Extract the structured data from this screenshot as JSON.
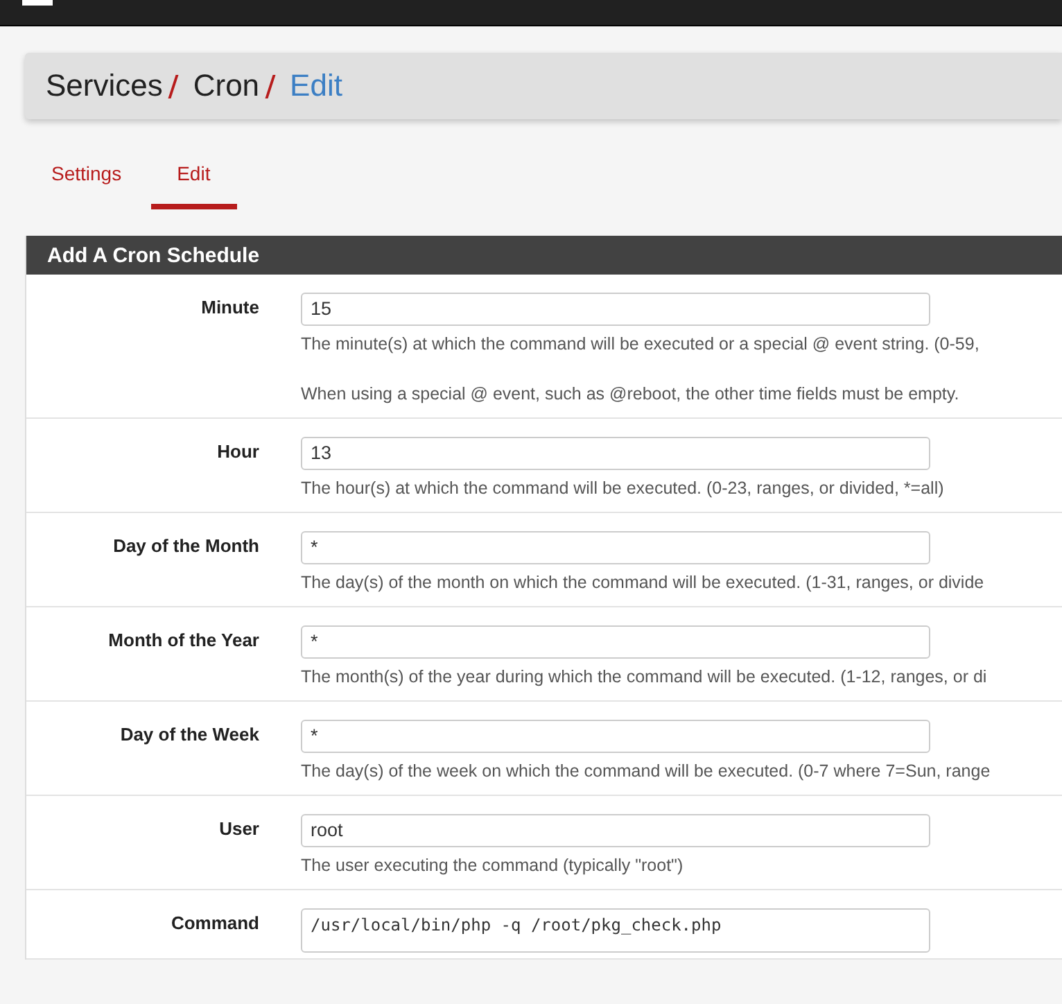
{
  "breadcrumb": [
    {
      "label": "Services",
      "current": false
    },
    {
      "label": "Cron",
      "current": false
    },
    {
      "label": "Edit",
      "current": true
    }
  ],
  "tabs": [
    {
      "label": "Settings",
      "selected": false
    },
    {
      "label": "Edit",
      "selected": true
    }
  ],
  "panel": {
    "title": "Add A Cron Schedule",
    "fields": [
      {
        "label": "Minute",
        "kind": "input",
        "value": "15",
        "help": [
          "The minute(s) at which the command will be executed or a special @ event string. (0-59,",
          "When using a special @ event, such as @reboot, the other time fields must be empty."
        ]
      },
      {
        "label": "Hour",
        "kind": "input",
        "value": "13",
        "help": [
          "The hour(s) at which the command will be executed. (0-23, ranges, or divided, *=all)"
        ]
      },
      {
        "label": "Day of the Month",
        "kind": "input",
        "value": "*",
        "help": [
          "The day(s) of the month on which the command will be executed. (1-31, ranges, or divide"
        ]
      },
      {
        "label": "Month of the Year",
        "kind": "input",
        "value": "*",
        "help": [
          "The month(s) of the year during which the command will be executed. (1-12, ranges, or di"
        ]
      },
      {
        "label": "Day of the Week",
        "kind": "input",
        "value": "*",
        "help": [
          "The day(s) of the week on which the command will be executed. (0-7 where 7=Sun, range"
        ]
      },
      {
        "label": "User",
        "kind": "input",
        "value": "root",
        "help": [
          "The user executing the command (typically \"root\")"
        ]
      },
      {
        "label": "Command",
        "kind": "textarea",
        "value": "/usr/local/bin/php -q /root/pkg_check.php"
      }
    ]
  }
}
